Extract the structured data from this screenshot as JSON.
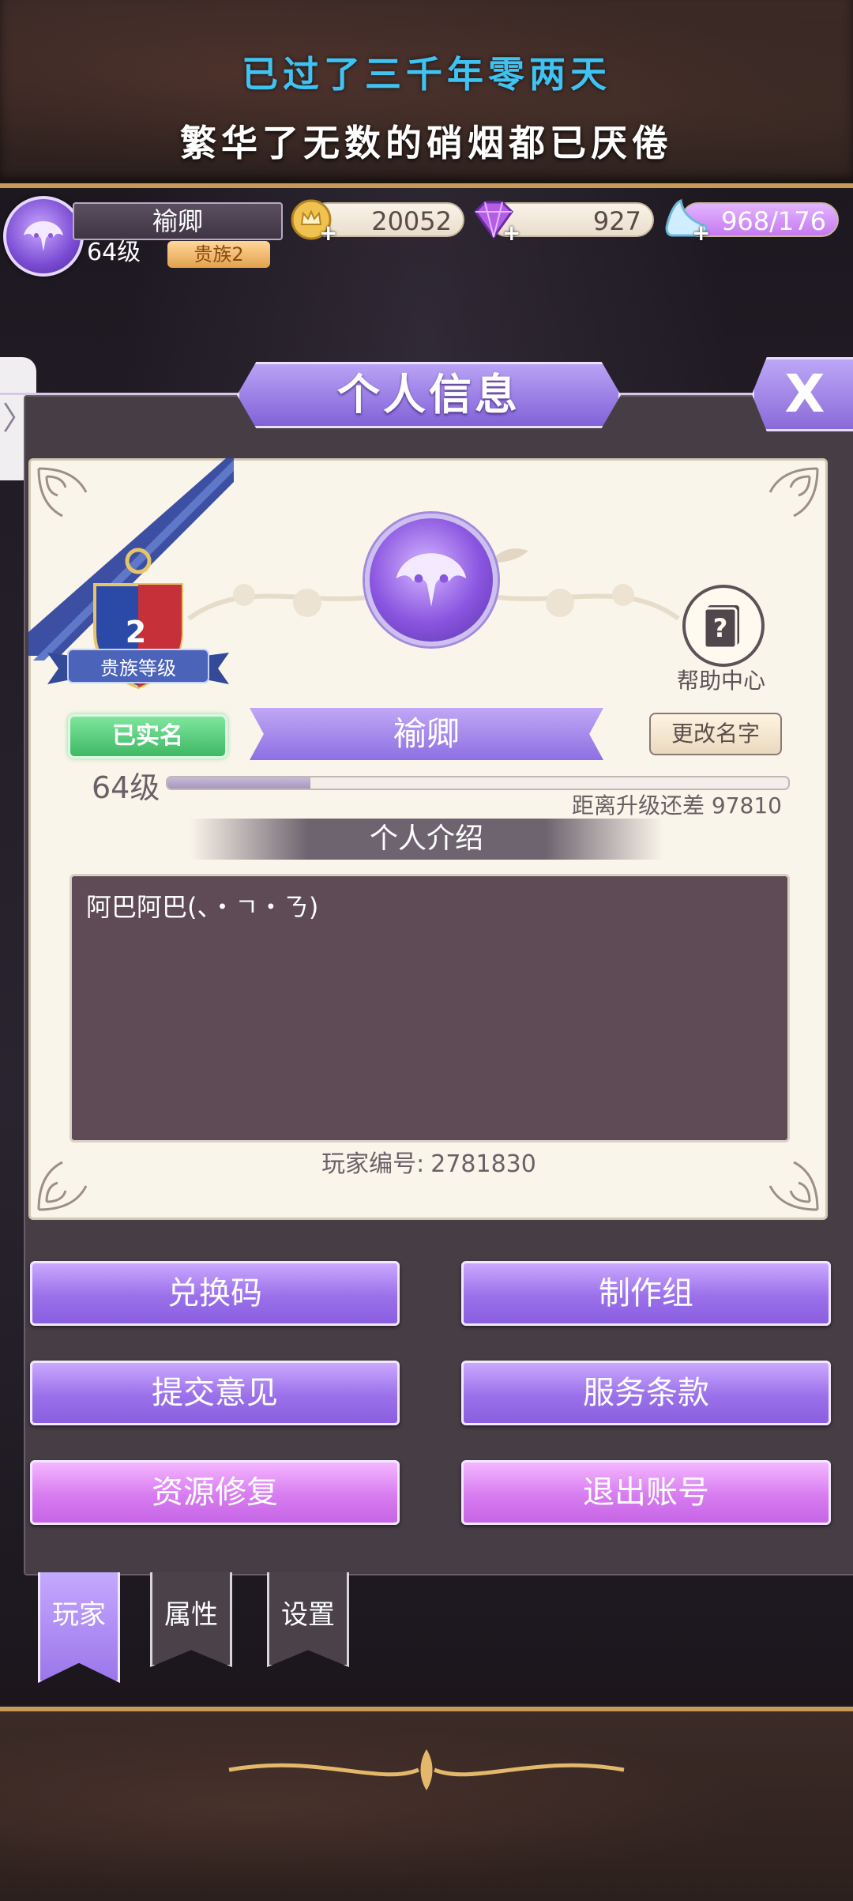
{
  "banner": {
    "lyric_line1": "已过了三千年零两天",
    "lyric_line2": "繁华了无数的硝烟都已厌倦"
  },
  "status": {
    "player_name": "褕卿",
    "level": "64级",
    "noble_badge": "贵族2",
    "gold": "20052",
    "gems": "927",
    "stamina": "968/176"
  },
  "panel": {
    "title": "个人信息",
    "close_label": "X"
  },
  "profile": {
    "noble_level_number": "2",
    "noble_level_label": "贵族等级",
    "help_center_label": "帮助中心",
    "verified_label": "已实名",
    "name": "褕卿",
    "rename_button": "更改名字",
    "level_text": "64级",
    "xp_progress": 0.23,
    "xp_remaining_text": "距离升级还差 97810",
    "intro_header": "个人介绍",
    "intro_text": "阿巴阿巴(、・ㄱ・ㄋ)",
    "player_id_label": "玩家编号:",
    "player_id": "2781830"
  },
  "actions": {
    "redeem_code": "兑换码",
    "credits": "制作组",
    "feedback": "提交意见",
    "terms": "服务条款",
    "repair": "资源修复",
    "logout": "退出账号"
  },
  "tabs": {
    "player": "玩家",
    "attributes": "属性",
    "settings": "设置"
  },
  "icons": {
    "avatar": "jester-mask-icon",
    "gold": "crown-coin-icon",
    "gems": "purple-diamond-icon",
    "stamina": "glass-slipper-icon",
    "help": "help-book-icon",
    "side_handle": "chevron-right-icon"
  },
  "colors": {
    "accent_purple": "#9b70ea",
    "accent_pink": "#d77cf0",
    "lyric_blue": "#3fc3f2",
    "verified_green": "#3fb865"
  }
}
